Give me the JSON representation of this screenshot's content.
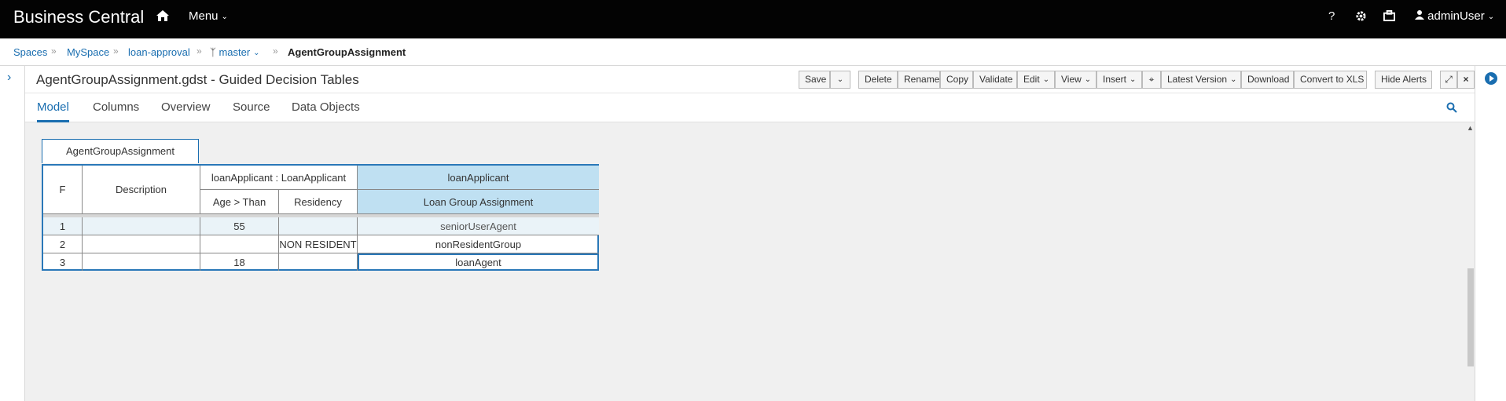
{
  "navbar": {
    "brand": "Business Central",
    "menu_label": "Menu",
    "help": "?",
    "user": "adminUser"
  },
  "breadcrumb": {
    "spaces": "Spaces",
    "myspace": "MySpace",
    "project": "loan-approval",
    "branch": "master",
    "current": "AgentGroupAssignment"
  },
  "editor": {
    "title": "AgentGroupAssignment.gdst - Guided Decision Tables",
    "toolbar": {
      "save": "Save",
      "delete": "Delete",
      "rename": "Rename",
      "copy": "Copy",
      "validate": "Validate",
      "edit": "Edit",
      "view": "View",
      "insert": "Insert",
      "latest_version": "Latest Version",
      "download": "Download",
      "convert": "Convert to XLS",
      "hide_alerts": "Hide Alerts"
    },
    "tabs": [
      "Model",
      "Columns",
      "Overview",
      "Source",
      "Data Objects"
    ]
  },
  "table": {
    "name": "AgentGroupAssignment",
    "headers": {
      "f": "F",
      "description": "Description",
      "condition_group": "loanApplicant : LoanApplicant",
      "action_group": "loanApplicant",
      "age": "Age > Than",
      "residency": "Residency",
      "assignment": "Loan Group Assignment"
    },
    "rows": [
      {
        "num": "1",
        "description": "",
        "age": "55",
        "residency": "",
        "assignment": "seniorUserAgent"
      },
      {
        "num": "2",
        "description": "",
        "age": "",
        "residency": "NON RESIDENT",
        "assignment": "nonResidentGroup"
      },
      {
        "num": "3",
        "description": "",
        "age": "18",
        "residency": "",
        "assignment": "loanAgent"
      }
    ]
  },
  "colors": {
    "accent": "#1a6eb0",
    "header_blue": "#bfe0f2"
  }
}
